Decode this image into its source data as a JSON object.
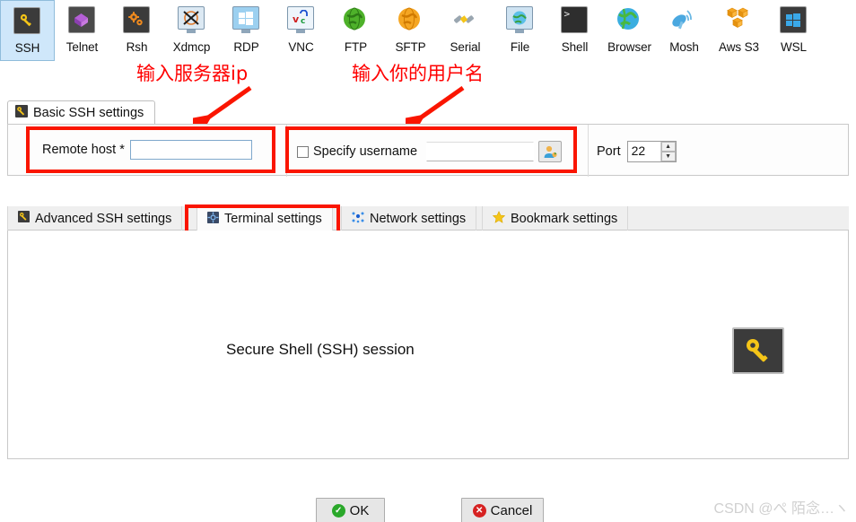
{
  "toolbar": {
    "items": [
      {
        "label": "SSH",
        "icon": "key-icon",
        "selected": true
      },
      {
        "label": "Telnet",
        "icon": "purple-cube-icon",
        "selected": false
      },
      {
        "label": "Rsh",
        "icon": "orange-gears-icon",
        "selected": false
      },
      {
        "label": "Xdmcp",
        "icon": "x-monitor-icon",
        "selected": false
      },
      {
        "label": "RDP",
        "icon": "windows-monitor-icon",
        "selected": false
      },
      {
        "label": "VNC",
        "icon": "vnc-monitor-icon",
        "selected": false
      },
      {
        "label": "FTP",
        "icon": "green-globe-icon",
        "selected": false
      },
      {
        "label": "SFTP",
        "icon": "orange-globe-icon",
        "selected": false
      },
      {
        "label": "Serial",
        "icon": "plug-connector-icon",
        "selected": false
      },
      {
        "label": "File",
        "icon": "globe-monitor-icon",
        "selected": false
      },
      {
        "label": "Shell",
        "icon": "terminal-prompt-icon",
        "selected": false
      },
      {
        "label": "Browser",
        "icon": "blue-globe-icon",
        "selected": false
      },
      {
        "label": "Mosh",
        "icon": "satellite-dish-icon",
        "selected": false
      },
      {
        "label": "Aws S3",
        "icon": "aws-cubes-icon",
        "selected": false
      },
      {
        "label": "WSL",
        "icon": "windows-logo-icon",
        "selected": false
      }
    ]
  },
  "annotations": {
    "host_note": "输入服务器ip",
    "user_note": "输入你的用户名",
    "color": "#ff0000"
  },
  "basic_settings": {
    "tab_label": "Basic SSH settings",
    "tab_icon": "key-small-icon",
    "remote_host_label": "Remote host *",
    "remote_host_value": "",
    "specify_username_label": "Specify username",
    "specify_username_checked": false,
    "username_value": "",
    "user_button_icon": "user-select-icon",
    "port_label": "Port",
    "port_value": "22"
  },
  "sub_tabs": {
    "items": [
      {
        "label": "Advanced SSH settings",
        "icon": "key-small-icon",
        "active": false
      },
      {
        "label": "Terminal settings",
        "icon": "terminal-icon",
        "active": true
      },
      {
        "label": "Network settings",
        "icon": "network-dots-icon",
        "active": false
      },
      {
        "label": "Bookmark settings",
        "icon": "star-icon",
        "active": false
      }
    ]
  },
  "content": {
    "session_title": "Secure Shell (SSH) session",
    "session_icon": "key-large-icon"
  },
  "footer": {
    "ok_label": "OK",
    "ok_icon": "check-circle-icon",
    "ok_color": "#2aa82a",
    "cancel_label": "Cancel",
    "cancel_icon": "x-circle-icon",
    "cancel_color": "#d62222",
    "watermark": "CSDN @ぺ 陌念…ヽ"
  }
}
